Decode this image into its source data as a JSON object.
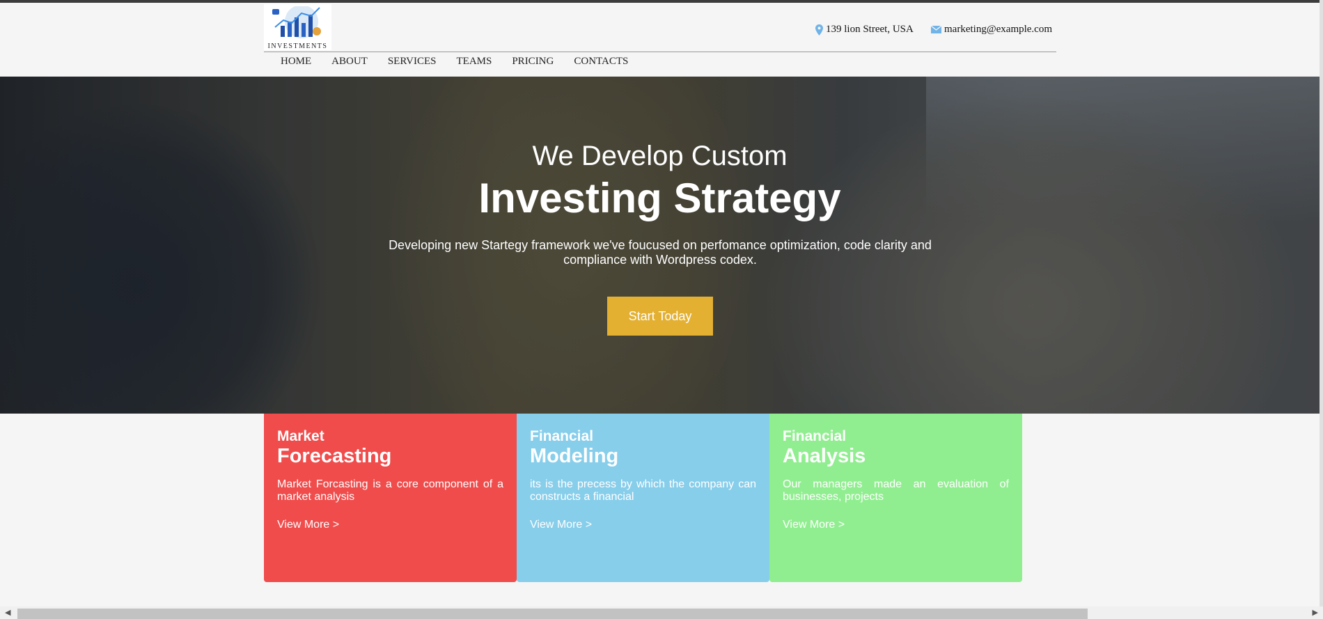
{
  "header": {
    "logo_text": "INVESTMENTS",
    "address": "139 lion Street, USA",
    "email": "marketing@example.com",
    "address_icon": "map-pin-icon",
    "email_icon": "envelope-icon"
  },
  "nav": {
    "items": [
      {
        "label": "HOME"
      },
      {
        "label": "ABOUT"
      },
      {
        "label": "SERVICES"
      },
      {
        "label": "TEAMS"
      },
      {
        "label": "PRICING"
      },
      {
        "label": "CONTACTS"
      }
    ]
  },
  "hero": {
    "subtitle": "We Develop Custom",
    "title": "Investing Strategy",
    "description": "Developing new Startegy framework we've foucused on perfomance optimization, code clarity and compliance with Wordpress codex.",
    "button_label": "Start Today",
    "button_color": "#e3b032"
  },
  "cards": [
    {
      "small": "Market",
      "big": "Forecasting",
      "text": "Market Forcasting is a core component of a market analysis",
      "link": "View More >",
      "color": "#f04c4c"
    },
    {
      "small": "Financial",
      "big": "Modeling",
      "text": "its is the precess by which the company can constructs a financial",
      "link": "View More >",
      "color": "#87ceeb"
    },
    {
      "small": "Financial",
      "big": "Analysis",
      "text": "Our managers made an evaluation of businesses, projects",
      "link": "View More >",
      "color": "#90ee90"
    }
  ],
  "scrollbar": {
    "left_arrow": "◀",
    "right_arrow": "▶"
  }
}
